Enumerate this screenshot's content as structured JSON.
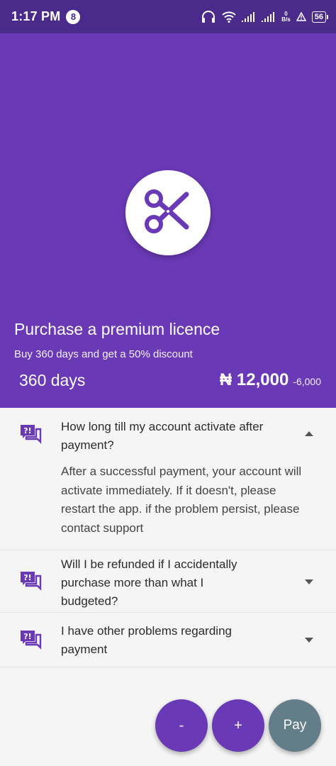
{
  "status_bar": {
    "time": "1:17 PM",
    "badge": "8",
    "net_speed_value": "0",
    "net_speed_unit": "B/s",
    "battery": "56"
  },
  "hero": {
    "logo_icon": "scissors-icon",
    "title": "Purchase a premium licence",
    "subtitle": "Buy 360 days and get a 50% discount",
    "plan_days": "360 days",
    "price": "₦ 12,000",
    "discount": "-6,000"
  },
  "faqs": [
    {
      "question": "How long till my account activate after payment?",
      "answer": "After a successful payment, your account will activate immediately. If it doesn't, please restart the app. if the problem persist, please contact support",
      "expanded": true
    },
    {
      "question": "Will I be refunded if I accidentally purchase more than what I budgeted?",
      "expanded": false
    },
    {
      "question": "I have other problems regarding payment",
      "expanded": false
    }
  ],
  "buttons": {
    "minus": "-",
    "plus": "+",
    "pay": "Pay"
  },
  "colors": {
    "primary": "#6a39b6",
    "status_bar": "#4a2a8a",
    "pay_button": "#637d89"
  }
}
